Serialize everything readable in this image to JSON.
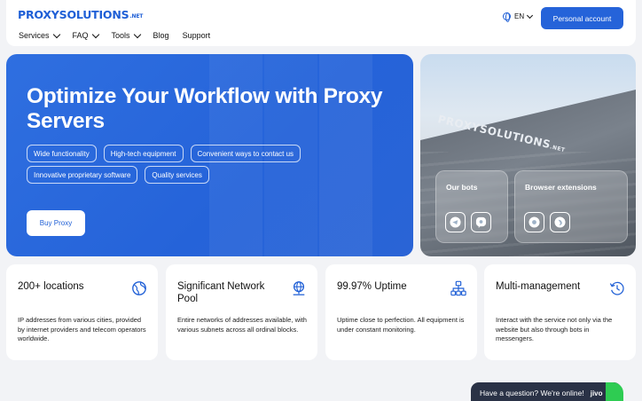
{
  "header": {
    "logo_main": "PROXYSOLUTIONS",
    "logo_suffix": ".NET",
    "nav": [
      {
        "label": "Services",
        "dropdown": true
      },
      {
        "label": "FAQ",
        "dropdown": true
      },
      {
        "label": "Tools",
        "dropdown": true
      },
      {
        "label": "Blog",
        "dropdown": false
      },
      {
        "label": "Support",
        "dropdown": false
      }
    ],
    "language": "EN",
    "account_button": "Personal account"
  },
  "hero": {
    "title": "Optimize Your Workflow with Proxy Servers",
    "tags": [
      "Wide functionality",
      "High-tech equipment",
      "Convenient ways to contact us",
      "Innovative proprietary software",
      "Quality services"
    ],
    "buy_button": "Buy Proxy"
  },
  "panel": {
    "sign_main": "PROXYSOLUTIONS",
    "sign_suffix": ".NET",
    "bots_title": "Our bots",
    "extensions_title": "Browser extensions"
  },
  "features": [
    {
      "title": "200+ locations",
      "text": "IP addresses from various cities, provided by internet providers and telecom operators worldwide.",
      "icon": "globe-icon"
    },
    {
      "title": "Significant Network Pool",
      "text": "Entire networks of addresses available, with various subnets across all ordinal blocks.",
      "icon": "network-icon"
    },
    {
      "title": "99.97% Uptime",
      "text": "Uptime close to perfection. All equipment is under constant monitoring.",
      "icon": "hierarchy-icon"
    },
    {
      "title": "Multi-management",
      "text": "Interact with the service not only via the website but also through bots in messengers.",
      "icon": "history-icon"
    }
  ],
  "chat": {
    "prompt": "Have a question? We're online!",
    "brand": "jivo"
  },
  "colors": {
    "accent": "#2563d9",
    "background": "#f2f3f6",
    "chat_bg": "#2a3246",
    "chat_green": "#2ecc52"
  }
}
